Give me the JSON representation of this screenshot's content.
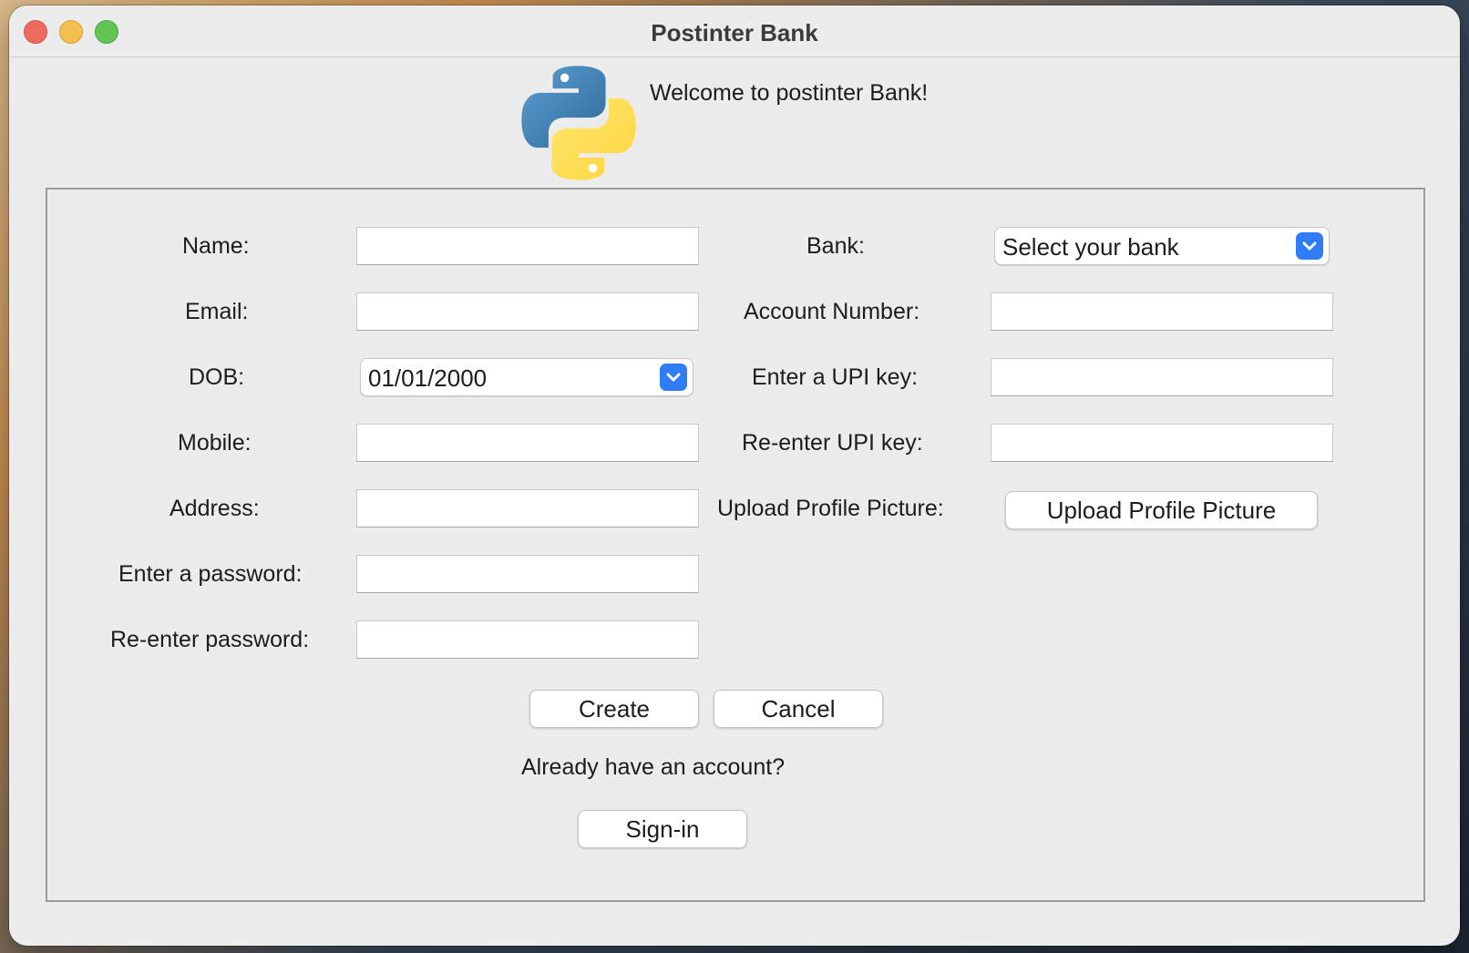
{
  "window": {
    "title": "Postinter Bank"
  },
  "header": {
    "welcome": "Welcome to postinter Bank!",
    "logo_icon": "python-logo"
  },
  "form": {
    "left": {
      "name_label": "Name:",
      "email_label": "Email:",
      "dob_label": "DOB:",
      "dob_value": "01/01/2000",
      "mobile_label": "Mobile:",
      "address_label": "Address:",
      "password_label": "Enter a password:",
      "repassword_label": "Re-enter password:"
    },
    "right": {
      "bank_label": "Bank:",
      "bank_value": "Select your bank",
      "account_label": "Account Number:",
      "upi_label": "Enter a UPI key:",
      "reupi_label": "Re-enter UPI key:",
      "upload_label": "Upload Profile Picture:",
      "upload_button": "Upload Profile Picture"
    },
    "create_button": "Create",
    "cancel_button": "Cancel",
    "have_account": "Already have an account?",
    "signin_button": "Sign-in"
  },
  "colors": {
    "accent": "#2f7cf6",
    "window_bg": "#ececec"
  }
}
